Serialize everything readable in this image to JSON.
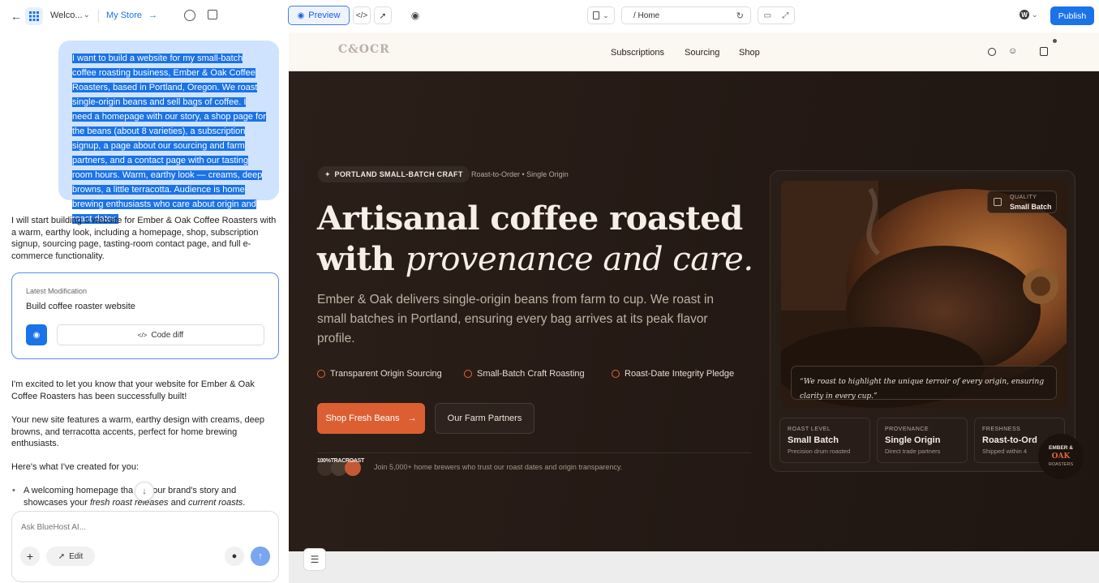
{
  "topbar": {
    "project_name": "Welco...",
    "store_link": "My Store",
    "preview_label": "Preview",
    "path": "/ Home",
    "publish_label": "Publish"
  },
  "prompt": {
    "text": "I want to build a website for my small-batch coffee roasting business, Ember & Oak Coffee Roasters, based in Portland, Oregon. We roast single-origin beans and sell bags of coffee. I need a homepage with our story, a shop page for the beans (about 8 varieties), a subscription signup, a page about our sourcing and farm partners, and a contact page with our tasting room hours. Warm, earthy look — creams, deep browns, a little terracotta. Audience is home brewing enthusiasts who care about origin and roast dates."
  },
  "assistant": {
    "intro": "I will start building a website for Ember & Oak Coffee Roasters with a warm, earthy look, including a homepage, shop, subscription signup, sourcing page, tasting-room contact page, and full e-commerce functionality.",
    "card_label": "Latest Modification",
    "card_title": "Build coffee roaster website",
    "code_diff": "Code diff",
    "done": "I'm excited to let you know that your website for Ember & Oak Coffee Roasters has been successfully built!",
    "features": "Your new site features a warm, earthy design with creams, deep browns, and terracotta accents, perfect for home brewing enthusiasts.",
    "heres": "Here's what I've created for you:",
    "bullet_a": "A welcoming homepage tha",
    "bullet_b": "s your brand's story and showcases your ",
    "bullet_em1": "fresh roast releases",
    "bullet_and": " and ",
    "bullet_em2": "current roasts",
    "bullet_end": "."
  },
  "chat": {
    "placeholder": "Ask BlueHost AI...",
    "edit_label": "Edit"
  },
  "site": {
    "logo": "C&OCR",
    "nav": [
      "Subscriptions",
      "Sourcing",
      "Shop"
    ],
    "badge": "PORTLAND SMALL-BATCH CRAFT",
    "badge_sub": "Roast-to-Order • Single Origin",
    "headline_1": "Artisanal coffee roasted",
    "headline_2a": "with ",
    "headline_2b": "provenance and care.",
    "lead": "Ember & Oak delivers single-origin beans from farm to cup. We roast in small batches in Portland, ensuring every bag arrives at its peak flavor profile.",
    "features": [
      "Transparent Origin Sourcing",
      "Small-Batch Craft Roasting",
      "Roast-Date Integrity Pledge"
    ],
    "cta_primary": "Shop Fresh Beans",
    "cta_secondary": "Our Farm Partners",
    "proof_tag": "100%TRACROAST",
    "proof_text": "Join 5,000+ home brewers who trust our roast dates and origin transparency.",
    "quality_label": "QUALITY",
    "quality_value": "Small Batch",
    "quote": "“We roast to highlight the unique terroir of every origin, ensuring clarity in every cup.”",
    "stats": [
      {
        "label": "ROAST LEVEL",
        "value": "Small Batch",
        "sub": "Precision drum roasted"
      },
      {
        "label": "PROVENANCE",
        "value": "Single Origin",
        "sub": "Direct trade partners"
      },
      {
        "label": "FRESHNESS",
        "value": "Roast-to-Ord",
        "sub": "Shipped within 4"
      }
    ],
    "seal_1": "EMBER &",
    "seal_2": "OAK",
    "seal_3": "ROASTERS"
  },
  "colors": {
    "accent": "#1a73e8",
    "terracotta": "#e0663a",
    "site_bg": "#241914",
    "cream": "#fbf7f1"
  }
}
